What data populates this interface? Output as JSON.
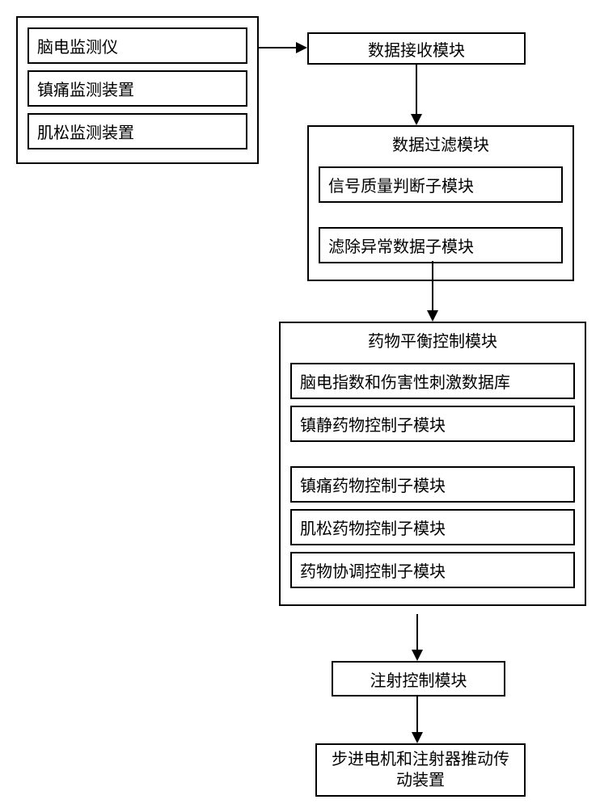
{
  "monitors": {
    "items": [
      "脑电监测仪",
      "镇痛监测装置",
      "肌松监测装置"
    ]
  },
  "receive": {
    "label": "数据接收模块"
  },
  "filter": {
    "title": "数据过滤模块",
    "items": [
      "信号质量判断子模块",
      "滤除异常数据子模块"
    ]
  },
  "drug": {
    "title": "药物平衡控制模块",
    "items": [
      "脑电指数和伤害性刺激数据库",
      "镇静药物控制子模块",
      "镇痛药物控制子模块",
      "肌松药物控制子模块",
      "药物协调控制子模块"
    ]
  },
  "inject": {
    "label": "注射控制模块"
  },
  "stepper": {
    "label": "步进电机和注射器推动传动装置"
  }
}
